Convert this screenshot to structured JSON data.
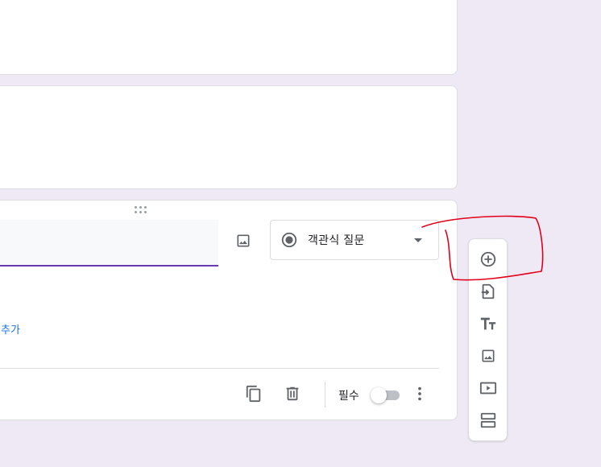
{
  "question_card": {
    "question_type": "객관식 질문",
    "add_option_partial": "추가",
    "required_label": "필수",
    "required_enabled": false
  },
  "side_toolbar": {
    "tools": [
      "add-circle-icon",
      "import-icon",
      "title-text-icon",
      "image-icon",
      "video-icon",
      "section-icon"
    ]
  },
  "colors": {
    "background": "#efe9f6",
    "accent": "#673ab7",
    "link": "#1a73e8",
    "annotation": "#e0001a"
  }
}
